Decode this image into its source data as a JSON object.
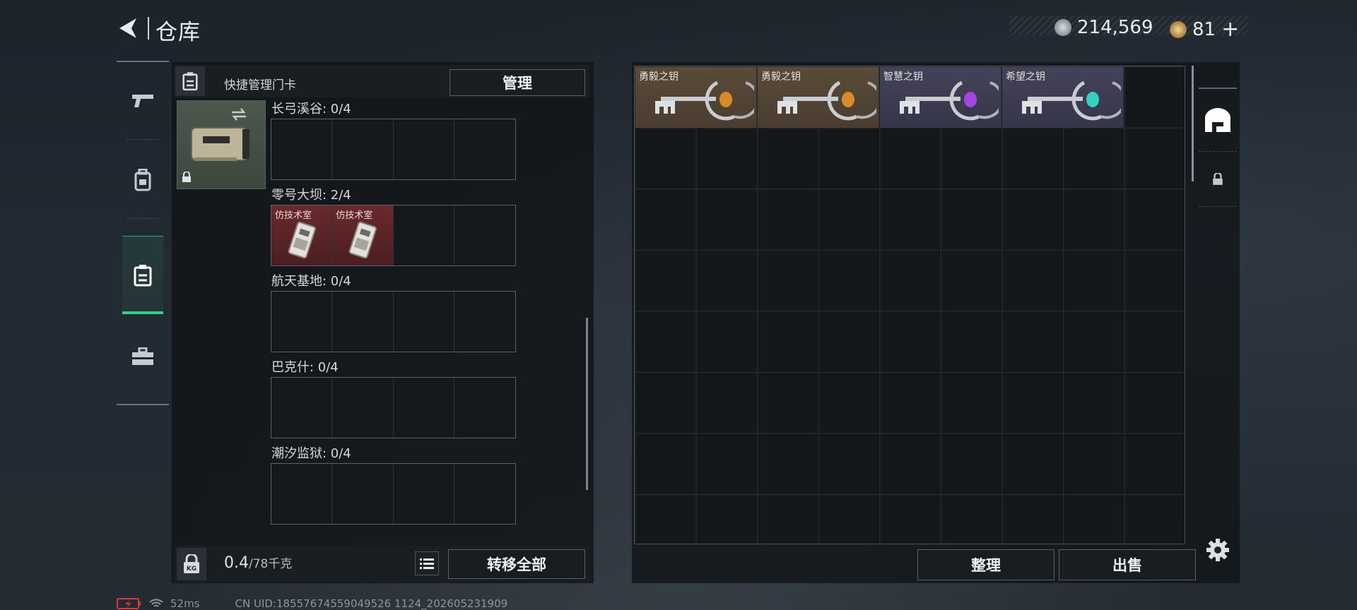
{
  "header": {
    "title": "仓库",
    "currency_main": "214,569",
    "currency_secondary": "81",
    "add_label": "+"
  },
  "nav": {
    "items": [
      {
        "name": "firearms",
        "icon": "gun-icon",
        "active": false
      },
      {
        "name": "gear",
        "icon": "backpack-icon",
        "active": false
      },
      {
        "name": "keycards",
        "icon": "keycard-icon",
        "active": true
      },
      {
        "name": "tools",
        "icon": "toolbox-icon",
        "active": false
      }
    ]
  },
  "keycard_panel": {
    "quick_manage_label": "快捷管理门卡",
    "manage_button": "管理",
    "zones": [
      {
        "label": "长弓溪谷: 0/4",
        "cards": []
      },
      {
        "label": "零号大坝: 2/4",
        "cards": [
          "仿技术室",
          "仿技术室"
        ]
      },
      {
        "label": "航天基地: 0/4",
        "cards": []
      },
      {
        "label": "巴克什: 0/4",
        "cards": []
      },
      {
        "label": "潮汐监狱: 0/4",
        "cards": []
      }
    ],
    "weight_value": "0.4",
    "weight_capacity": "/78千克",
    "transfer_all_button": "转移全部"
  },
  "stash": {
    "items": [
      {
        "name": "勇毅之钥",
        "rarity_color": "#d98a2b"
      },
      {
        "name": "勇毅之钥",
        "rarity_color": "#d98a2b"
      },
      {
        "name": "智慧之钥",
        "rarity_color": "#a347e0"
      },
      {
        "name": "希望之钥",
        "rarity_color": "#33d1c2"
      }
    ],
    "sort_button": "整理",
    "sell_button": "出售"
  },
  "status_bar": {
    "ping": "52ms",
    "uid": "CN UID:18557674559049526 1124_202605231909"
  },
  "colors": {
    "accent_green": "#2fd18c",
    "filled_card_red": "#6a2a2c"
  }
}
